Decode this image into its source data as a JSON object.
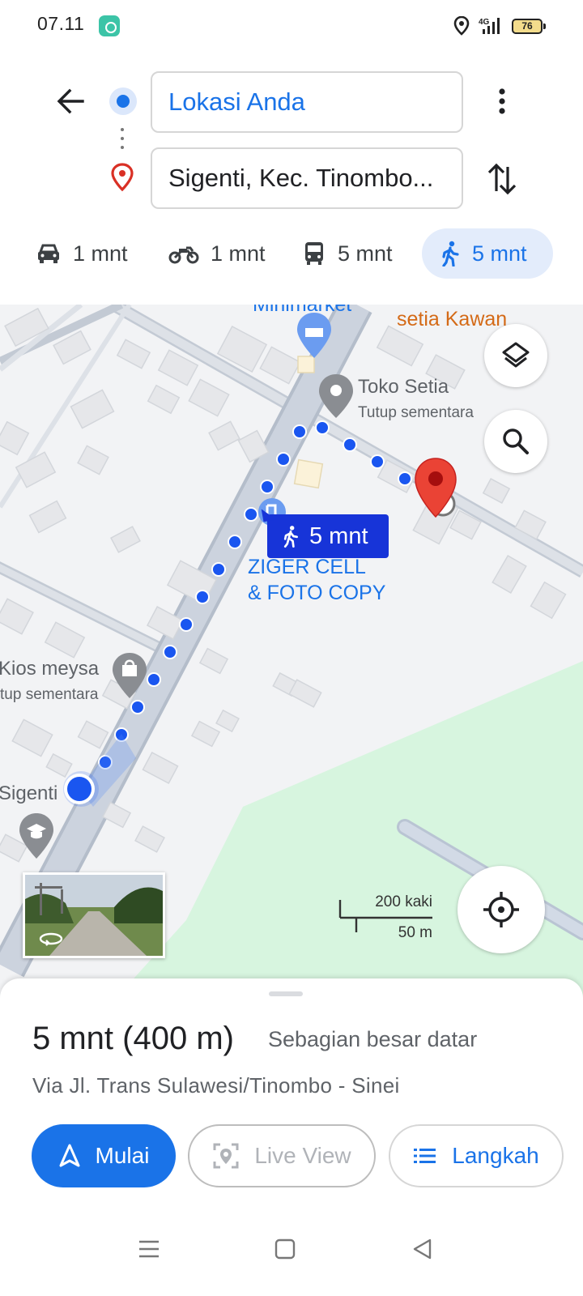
{
  "status_bar": {
    "time": "07.11",
    "battery": "76",
    "network": "4G"
  },
  "directions": {
    "origin": "Lokasi Anda",
    "destination": "Sigenti, Kec. Tinombo..."
  },
  "modes": [
    {
      "name": "driving",
      "icon": "car-icon",
      "label": "1 mnt"
    },
    {
      "name": "motorcycle",
      "icon": "motorcycle-icon",
      "label": "1 mnt"
    },
    {
      "name": "transit",
      "icon": "bus-icon",
      "label": "5 mnt"
    },
    {
      "name": "walking",
      "icon": "walking-icon",
      "label": "5 mnt",
      "selected": true
    }
  ],
  "map": {
    "labels": {
      "minimarket": "Minimarket",
      "setia_kawan": "setia Kawan",
      "toko_setia": "Toko Setia",
      "toko_setia_status": "Tutup sementara",
      "ziger_line1": "ZIGER CELL",
      "ziger_line2": "& FOTO COPY",
      "kios_meysa": "Kios meysa",
      "kios_status": "tup sementara",
      "sigenti": "Sigenti"
    },
    "route_badge": "5 mnt",
    "scale": {
      "imperial": "200 kaki",
      "metric": "50 m"
    }
  },
  "sheet": {
    "time_distance": "5 mnt (400 m)",
    "terrain": "Sebagian besar datar",
    "via": "Via Jl. Trans Sulawesi/Tinombo - Sinei",
    "buttons": {
      "start": "Mulai",
      "live_view": "Live View",
      "steps": "Langkah"
    }
  },
  "colors": {
    "accent": "#1a73e8",
    "route": "#1a56f0",
    "pin": "#ea4335",
    "park": "#d7f5df"
  }
}
